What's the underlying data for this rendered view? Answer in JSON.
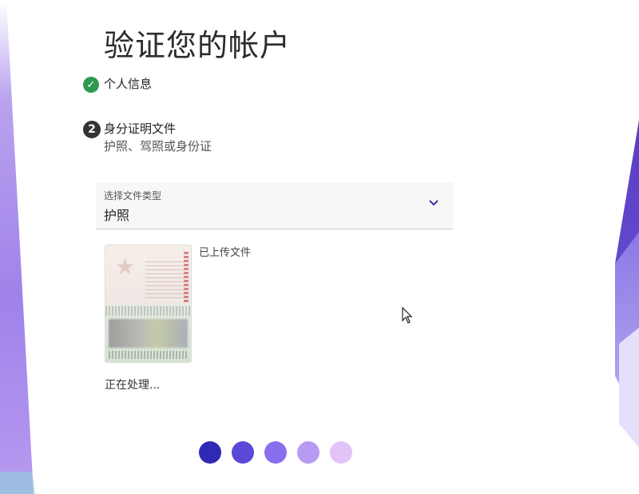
{
  "page": {
    "title": "验证您的帐户"
  },
  "steps": [
    {
      "status": "complete",
      "label": "个人信息",
      "icon": "check-circle-icon",
      "color": "#2f9a4f"
    },
    {
      "status": "current",
      "number": "2",
      "label": "身分证明文件",
      "sublabel": "护照、驾照或身份证"
    }
  ],
  "document_select": {
    "caption": "选择文件类型",
    "value": "护照",
    "icon": "chevron-down-icon"
  },
  "upload": {
    "status_label": "已上传文件",
    "processing_text": "正在处理..."
  },
  "progress_dots": {
    "colors": [
      "#2e2ab5",
      "#5b49d8",
      "#8a6ef0",
      "#b79bf3",
      "#e2c3f7"
    ]
  },
  "colors": {
    "accent": "#5b49d8",
    "success": "#2f9a4f"
  }
}
